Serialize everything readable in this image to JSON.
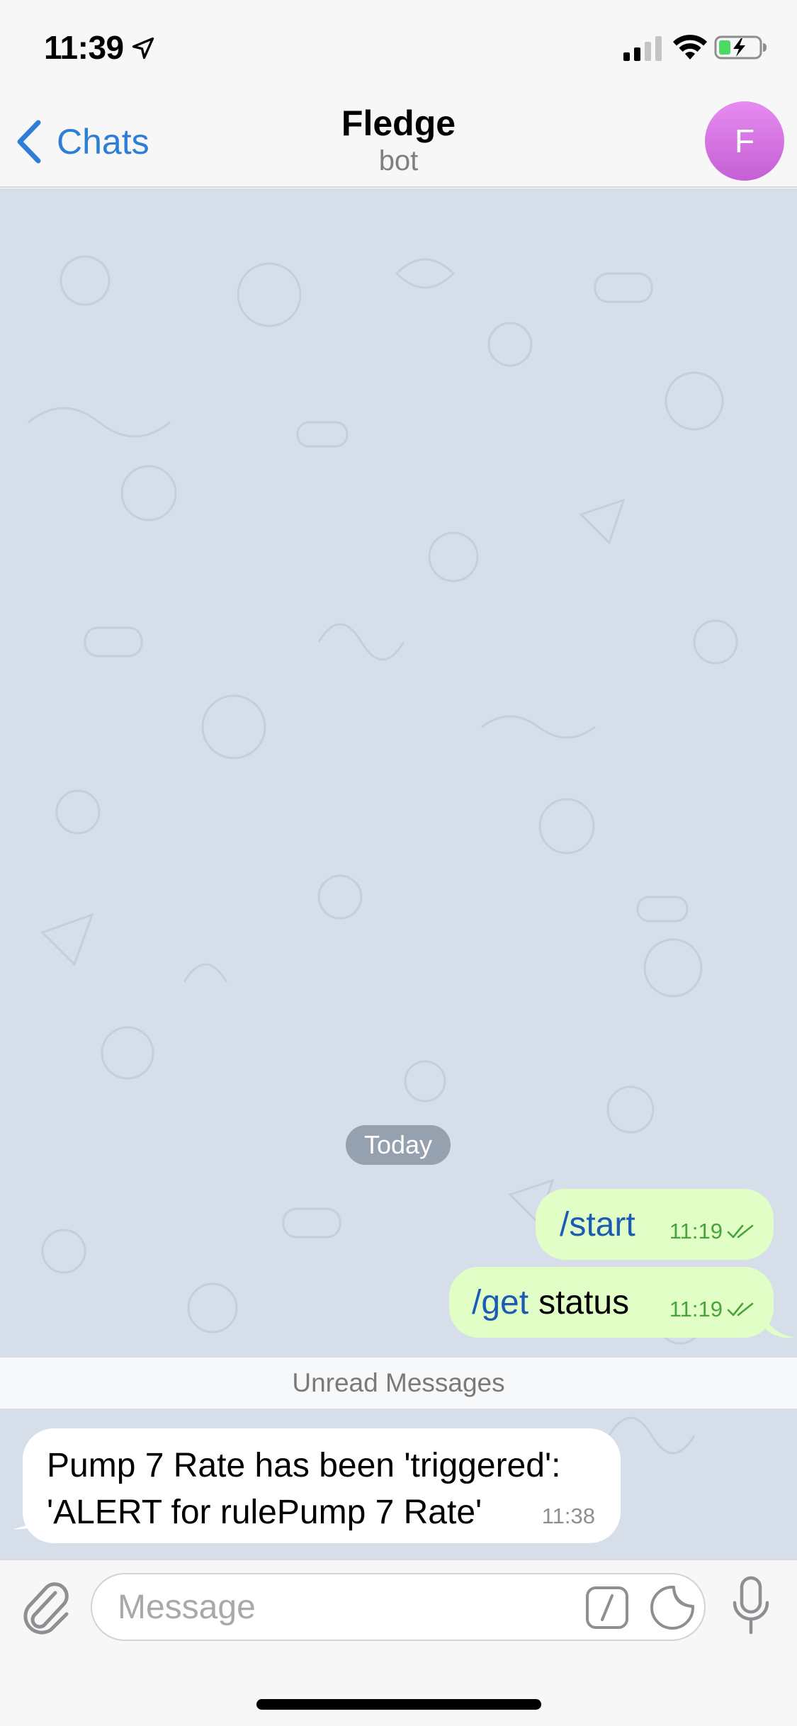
{
  "status_bar": {
    "time": "11:39",
    "icons": [
      "location-arrow-icon",
      "cellular-signal-icon",
      "wifi-icon",
      "battery-charging-icon"
    ]
  },
  "header": {
    "back_label": "Chats",
    "title": "Fledge",
    "subtitle": "bot",
    "avatar_initial": "F",
    "avatar_color": "#d877e3"
  },
  "chat": {
    "date_separator": "Today",
    "outgoing": [
      {
        "command": "/start",
        "text": "",
        "time": "11:19",
        "read": true
      },
      {
        "command": "/get",
        "text": "status",
        "time": "11:19",
        "read": true
      }
    ],
    "unread_label": "Unread Messages",
    "incoming": [
      {
        "lines": [
          "Pump 7 Rate has been 'triggered':",
          "'ALERT for rulePump 7 Rate'"
        ],
        "time": "11:38"
      }
    ]
  },
  "input": {
    "placeholder": "Message",
    "icons": [
      "paperclip-icon",
      "bot-command-icon",
      "sticker-icon",
      "microphone-icon"
    ]
  },
  "colors": {
    "accent": "#2d7ed6",
    "outgoing_bubble": "#e1fec6",
    "outgoing_meta": "#4aa33a",
    "chat_background": "#d6dfe9",
    "command_link": "#1c5bb4"
  }
}
